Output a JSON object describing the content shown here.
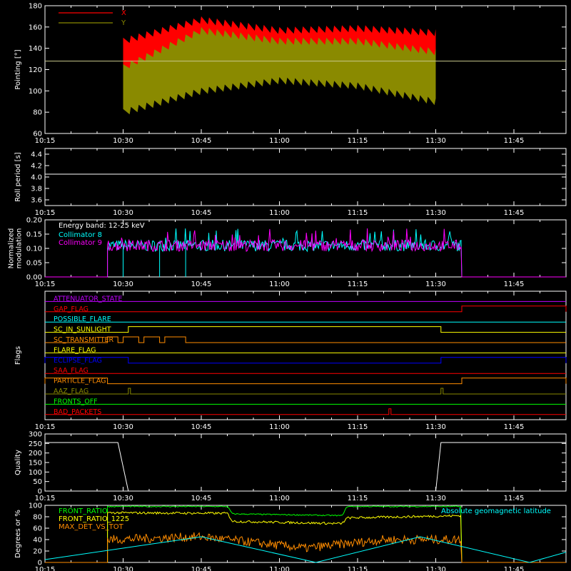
{
  "time_axis": {
    "ticks": [
      "10:15",
      "10:30",
      "10:45",
      "11:00",
      "11:15",
      "11:30",
      "11:45"
    ]
  },
  "colors": {
    "background": "#000000",
    "axes": "#ffffff",
    "red": "#ff0000",
    "olive": "#8a8a00",
    "cyan": "#00ffff",
    "magenta": "#ff00ff",
    "orange": "#ff8c00",
    "green": "#00ff00",
    "yellow": "#ffff00",
    "blue": "#0000ff",
    "purple": "#c000ff"
  },
  "chart_data": [
    {
      "type": "line",
      "ylabel": "Pointing [°]",
      "ylim": [
        60,
        180
      ],
      "y_ticks": [
        "60",
        "80",
        "100",
        "120",
        "140",
        "160",
        "180"
      ],
      "legend": [
        "X",
        "Y"
      ],
      "series": [
        {
          "name": "X",
          "color": "#ff0000",
          "x": [
            "10:30",
            "10:45",
            "11:00",
            "11:15",
            "11:30"
          ],
          "upper": [
            150,
            170,
            160,
            162,
            158
          ],
          "lower": [
            80,
            120,
            130,
            128,
            130
          ]
        },
        {
          "name": "Y",
          "color": "#8a8a00",
          "x": [
            "10:30",
            "10:45",
            "11:00",
            "11:15",
            "11:30"
          ],
          "upper": [
            125,
            160,
            150,
            150,
            140
          ],
          "lower": [
            75,
            95,
            105,
            100,
            85
          ]
        }
      ],
      "reference_line": 128
    },
    {
      "type": "line",
      "ylabel": "Roll period [s]",
      "ylim": [
        3.5,
        4.5
      ],
      "y_ticks": [
        "3.6",
        "3.8",
        "4.0",
        "4.2",
        "4.4"
      ],
      "series": [
        {
          "name": "",
          "color": "#ffffff",
          "x": [
            "10:15",
            "11:55"
          ],
          "values": [
            4.05,
            4.05
          ]
        }
      ]
    },
    {
      "type": "line",
      "ylabel_lines": [
        "Normalized",
        "modulation"
      ],
      "ylim": [
        0,
        0.2
      ],
      "y_ticks": [
        "0.00",
        "0.05",
        "0.10",
        "0.15",
        "0.20"
      ],
      "annotation": "Energy band: 12-25 keV",
      "legend": [
        "Collimator 8",
        "Collimator 9"
      ],
      "active_range": [
        "10:27",
        "11:35"
      ],
      "mean": 0.11,
      "noise": 0.02,
      "series": [
        {
          "name": "Collimator 8",
          "color": "#00ffff"
        },
        {
          "name": "Collimator 9",
          "color": "#ff00ff"
        }
      ],
      "dropouts": [
        "10:30",
        "10:37",
        "10:42"
      ]
    },
    {
      "type": "table",
      "ylabel": "Flags",
      "flags": [
        {
          "name": "ATTENUATOR_STATE",
          "color": "#c000ff",
          "segments": []
        },
        {
          "name": "GAP_FLAG",
          "color": "#ff0000",
          "segments": [
            [
              "11:35",
              "11:55"
            ]
          ]
        },
        {
          "name": "POSSIBLE_FLARE",
          "color": "#00ffff",
          "segments": []
        },
        {
          "name": "SC_IN_SUNLIGHT",
          "color": "#ffff00",
          "segments": [
            [
              "10:31",
              "11:31"
            ]
          ]
        },
        {
          "name": "SC_TRANSMITTER",
          "color": "#ff8c00",
          "segments": [
            [
              "10:27",
              "10:29"
            ],
            [
              "10:30",
              "10:33"
            ],
            [
              "10:34",
              "10:37"
            ],
            [
              "10:38",
              "10:42"
            ]
          ]
        },
        {
          "name": "FLARE_FLAG",
          "color": "#ffff00",
          "segments": []
        },
        {
          "name": "ECLIPSE_FLAG",
          "color": "#0000ff",
          "segments": [
            [
              "10:15",
              "10:31"
            ],
            [
              "11:31",
              "11:55"
            ]
          ]
        },
        {
          "name": "SAA_FLAG",
          "color": "#ff0000",
          "segments": []
        },
        {
          "name": "PARTICLE_FLAG",
          "color": "#ff8c00",
          "segments": [
            [
              "10:15",
              "10:27"
            ],
            [
              "11:35",
              "11:55"
            ]
          ]
        },
        {
          "name": "AAZ_FLAG",
          "color": "#8a8a00",
          "segments": [
            [
              "10:31",
              "10:31"
            ],
            [
              "11:31",
              "11:31"
            ]
          ]
        },
        {
          "name": "FRONTS_OFF",
          "color": "#00ff00",
          "segments": []
        },
        {
          "name": "BAD_PACKETS",
          "color": "#ff0000",
          "segments": [
            [
              "11:21",
              "11:21"
            ]
          ]
        }
      ]
    },
    {
      "type": "line",
      "ylabel": "Quality",
      "ylim": [
        0,
        300
      ],
      "y_ticks": [
        "0",
        "50",
        "100",
        "150",
        "200",
        "250",
        "300"
      ],
      "series": [
        {
          "name": "",
          "color": "#ffffff",
          "segments": [
            {
              "x": [
                "10:15",
                "10:29",
                "10:31"
              ],
              "values": [
                255,
                255,
                0
              ]
            },
            {
              "x": [
                "11:30",
                "11:31",
                "11:55"
              ],
              "values": [
                0,
                255,
                255
              ]
            }
          ]
        }
      ]
    },
    {
      "type": "line",
      "ylabel": "Degrees or %",
      "ylim": [
        0,
        100
      ],
      "y_ticks": [
        "0",
        "20",
        "40",
        "60",
        "80",
        "100"
      ],
      "legend": [
        "FRONT_RATIO",
        "FRONT_RATIO_1225",
        "MAX_DET_VS_TOT"
      ],
      "right_label": "Absolute geomagnetic latitude",
      "series": [
        {
          "name": "FRONT_RATIO",
          "color": "#00ff00",
          "x": [
            "10:27",
            "10:50",
            "10:51",
            "11:12",
            "11:13",
            "11:35"
          ],
          "values": [
            98,
            98,
            85,
            82,
            98,
            98
          ]
        },
        {
          "name": "FRONT_RATIO_1225",
          "color": "#ffff00",
          "x": [
            "10:27",
            "10:50",
            "10:51",
            "11:12",
            "11:13",
            "11:35"
          ],
          "values": [
            87,
            86,
            72,
            68,
            78,
            82
          ]
        },
        {
          "name": "MAX_DET_VS_TOT",
          "color": "#ff8c00",
          "x": [
            "10:27",
            "10:45",
            "11:05",
            "11:20",
            "11:35"
          ],
          "values": [
            40,
            45,
            25,
            40,
            40
          ]
        },
        {
          "name": "Absolute geomagnetic latitude",
          "color": "#00ffff",
          "x": [
            "10:15",
            "10:45",
            "11:07",
            "11:27",
            "11:48",
            "11:55"
          ],
          "values": [
            5,
            45,
            0,
            45,
            0,
            18
          ]
        }
      ]
    }
  ]
}
